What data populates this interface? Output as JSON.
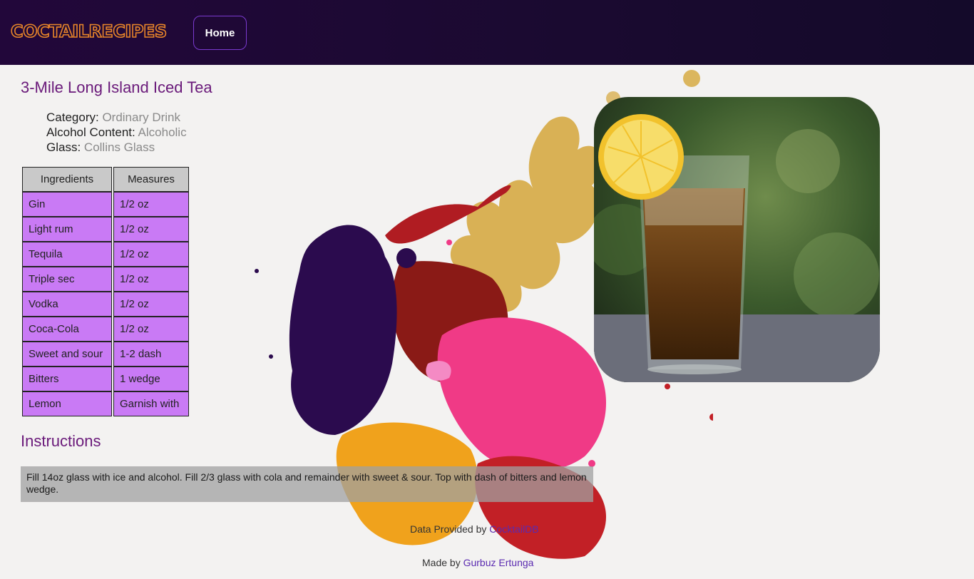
{
  "header": {
    "logo": "COCTAILRECIPES",
    "home_label": "Home"
  },
  "drink": {
    "name": "3-Mile Long Island Iced Tea",
    "category_label": "Category:",
    "category": "Ordinary Drink",
    "alcohol_label": "Alcohol Content:",
    "alcohol": "Alcoholic",
    "glass_label": "Glass:",
    "glass": "Collins Glass"
  },
  "table": {
    "headers": [
      "Ingredients",
      "Measures"
    ],
    "rows": [
      [
        "Gin",
        "1/2 oz"
      ],
      [
        "Light rum",
        "1/2 oz"
      ],
      [
        "Tequila",
        "1/2 oz"
      ],
      [
        "Triple sec",
        "1/2 oz"
      ],
      [
        "Vodka",
        "1/2 oz"
      ],
      [
        "Coca-Cola",
        "1/2 oz"
      ],
      [
        "Sweet and sour",
        "1-2 dash"
      ],
      [
        "Bitters",
        "1 wedge"
      ],
      [
        "Lemon",
        "Garnish with"
      ]
    ]
  },
  "instructions": {
    "title": "Instructions",
    "text": "Fill 14oz glass with ice and alcohol. Fill 2/3 glass with cola and remainder with sweet & sour. Top with dash of bitters and lemon wedge."
  },
  "footer": {
    "data_prefix": "Data Provided by",
    "data_link": "CocktailDB",
    "made_prefix": "Made by",
    "made_link": "Gurbuz Ertunga"
  },
  "colors": {
    "nav_bg": "#1a0a30",
    "logo": "#e9852a",
    "title": "#6a1a7a",
    "cell": "#c97af5"
  }
}
